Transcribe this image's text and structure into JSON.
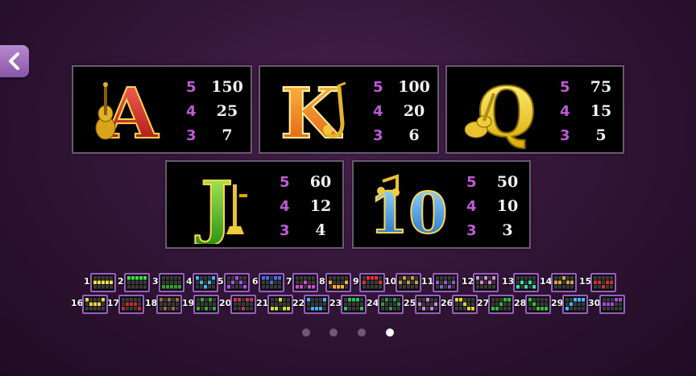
{
  "nav": {
    "back_icon": "chevron-left-icon"
  },
  "symbols": [
    {
      "id": "A",
      "letter": "A",
      "instrument": "violin-icon",
      "colors": [
        "#ff4a3a",
        "#a80d0d"
      ],
      "pays": [
        {
          "n": "5",
          "v": "150"
        },
        {
          "n": "4",
          "v": "25"
        },
        {
          "n": "3",
          "v": "7"
        }
      ]
    },
    {
      "id": "K",
      "letter": "K",
      "instrument": "saxophone-icon",
      "colors": [
        "#ffb233",
        "#e5620a"
      ],
      "pays": [
        {
          "n": "5",
          "v": "100"
        },
        {
          "n": "4",
          "v": "20"
        },
        {
          "n": "3",
          "v": "6"
        }
      ]
    },
    {
      "id": "Q",
      "letter": "Q",
      "instrument": "guitar-icon",
      "colors": [
        "#fff26a",
        "#d6a900"
      ],
      "pays": [
        {
          "n": "5",
          "v": "75"
        },
        {
          "n": "4",
          "v": "15"
        },
        {
          "n": "3",
          "v": "5"
        }
      ]
    },
    {
      "id": "J",
      "letter": "J",
      "instrument": "trumpet-icon",
      "colors": [
        "#9fe84a",
        "#2c9a18"
      ],
      "pays": [
        {
          "n": "5",
          "v": "60"
        },
        {
          "n": "4",
          "v": "12"
        },
        {
          "n": "3",
          "v": "4"
        }
      ]
    },
    {
      "id": "10",
      "letter": "10",
      "instrument": "music-note-icon",
      "colors": [
        "#8fd8ff",
        "#1778d4"
      ],
      "pays": [
        {
          "n": "5",
          "v": "50"
        },
        {
          "n": "4",
          "v": "10"
        },
        {
          "n": "3",
          "v": "3"
        }
      ]
    }
  ],
  "paylines": [
    {
      "num": "1",
      "color": "#f2e24a"
    },
    {
      "num": "2",
      "color": "#3ddc4b"
    },
    {
      "num": "3",
      "color": "#2ea52e"
    },
    {
      "num": "4",
      "color": "#3ab7ff"
    },
    {
      "num": "5",
      "color": "#b14cff"
    },
    {
      "num": "6",
      "color": "#4d6bff"
    },
    {
      "num": "7",
      "color": "#d24bd8"
    },
    {
      "num": "8",
      "color": "#ffb02e"
    },
    {
      "num": "9",
      "color": "#e8323c"
    },
    {
      "num": "10",
      "color": "#c9a03a"
    },
    {
      "num": "11",
      "color": "#8a5cd6"
    },
    {
      "num": "12",
      "color": "#e08ae0"
    },
    {
      "num": "13",
      "color": "#39e0b0"
    },
    {
      "num": "14",
      "color": "#d9a24a"
    },
    {
      "num": "15",
      "color": "#d8302e"
    },
    {
      "num": "16",
      "color": "#f4d43a"
    },
    {
      "num": "17",
      "color": "#cf2432"
    },
    {
      "num": "18",
      "color": "#a3673a"
    },
    {
      "num": "19",
      "color": "#3aa63a"
    },
    {
      "num": "20",
      "color": "#c23a62"
    },
    {
      "num": "21",
      "color": "#c8e632"
    },
    {
      "num": "22",
      "color": "#4ab0ff"
    },
    {
      "num": "23",
      "color": "#28c25a"
    },
    {
      "num": "24",
      "color": "#2c9a4a"
    },
    {
      "num": "25",
      "color": "#d680e6"
    },
    {
      "num": "26",
      "color": "#e6d23a"
    },
    {
      "num": "27",
      "color": "#2fbf3a"
    },
    {
      "num": "28",
      "color": "#36c436"
    },
    {
      "num": "29",
      "color": "#46b8ff"
    },
    {
      "num": "30",
      "color": "#a64ad6"
    }
  ],
  "pagination": {
    "total": 4,
    "active": 4
  }
}
